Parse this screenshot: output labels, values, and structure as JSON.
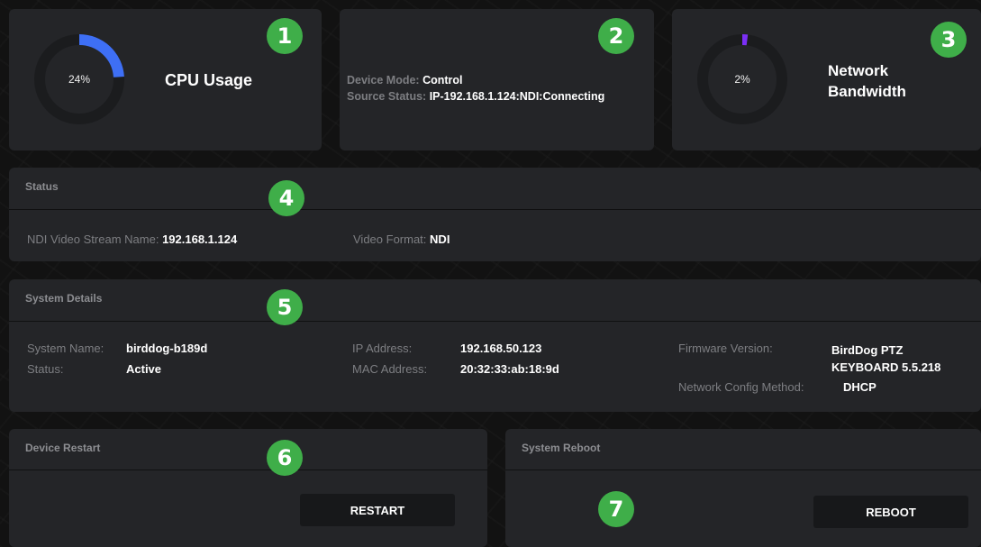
{
  "cpu": {
    "value_text": "24%",
    "fraction": 0.24,
    "label": "CPU Usage",
    "color": "#3e6ff5",
    "badge": "1"
  },
  "device": {
    "badge": "2",
    "mode_label": "Device Mode:",
    "mode_value": "Control",
    "source_label": "Source Status:",
    "source_value": "IP-192.168.1.124:NDI:Connecting"
  },
  "network": {
    "value_text": "2%",
    "fraction": 0.02,
    "label_line1": "Network",
    "label_line2": "Bandwidth",
    "color": "#7b2ff5",
    "badge": "3"
  },
  "status": {
    "title": "Status",
    "badge": "4",
    "stream_label": "NDI Video Stream Name:",
    "stream_value": "192.168.1.124",
    "format_label": "Video Format:",
    "format_value": "NDI"
  },
  "system": {
    "title": "System Details",
    "badge": "5",
    "name_label": "System Name:",
    "name_value": "birddog-b189d",
    "status_label": "Status:",
    "status_value": "Active",
    "ip_label": "IP Address:",
    "ip_value": "192.168.50.123",
    "mac_label": "MAC Address:",
    "mac_value": "20:32:33:ab:18:9d",
    "fw_label": "Firmware Version:",
    "fw_value_line1": "BirdDog PTZ",
    "fw_value_line2": "KEYBOARD 5.5.218",
    "netcfg_label": "Network Config Method:",
    "netcfg_value": "DHCP"
  },
  "restart": {
    "title": "Device Restart",
    "button": "RESTART",
    "badge": "6"
  },
  "reboot": {
    "title": "System Reboot",
    "button": "REBOOT",
    "badge": "7"
  },
  "colors": {
    "badge": "#3fae49",
    "card": "#242528",
    "track": "#1b1c1e"
  }
}
